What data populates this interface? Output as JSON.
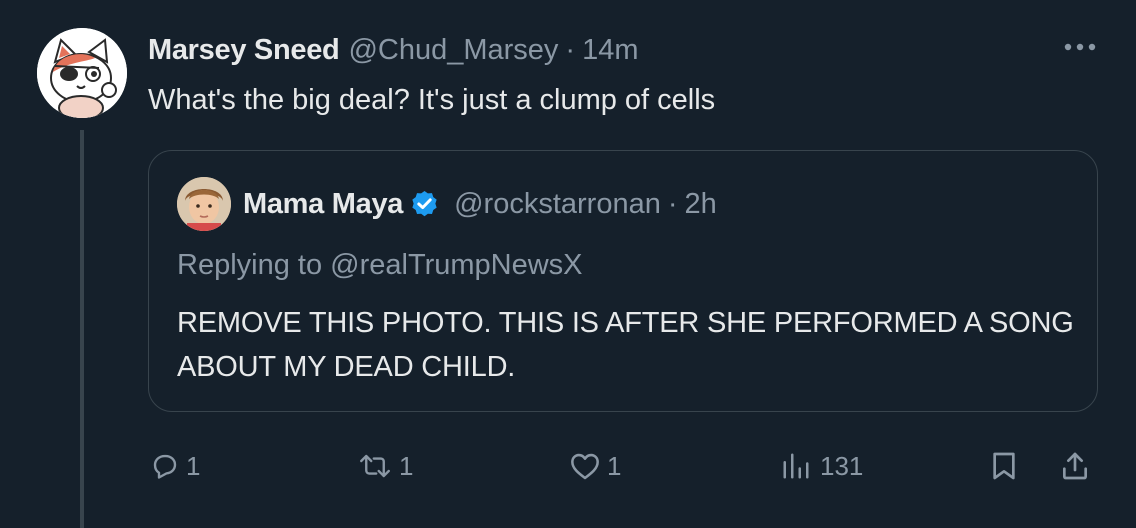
{
  "tweet": {
    "display_name": "Marsey Sneed",
    "handle": "@Chud_Marsey",
    "separator": "·",
    "time": "14m",
    "text": "What's the big deal? It's just a clump of cells"
  },
  "quote": {
    "display_name": "Mama Maya",
    "verified": true,
    "handle": "@rockstarronan",
    "separator": "·",
    "time": "2h",
    "replying_to": "Replying to @realTrumpNewsX",
    "text": "REMOVE THIS PHOTO. THIS IS AFTER SHE PERFORMED A SONG ABOUT MY DEAD CHILD."
  },
  "actions": {
    "replies": "1",
    "reposts": "1",
    "likes": "1",
    "views": "131"
  },
  "colors": {
    "background": "#15202b",
    "primary_text": "#e7e9ea",
    "secondary_text": "#8b98a5",
    "border": "#38444d",
    "verified_badge": "#1d9bf0"
  },
  "icons": {
    "more": "more-horizontal-icon",
    "verified": "verified-badge-icon",
    "reply": "reply-icon",
    "repost": "repost-icon",
    "like": "heart-icon",
    "views": "analytics-icon",
    "bookmark": "bookmark-icon",
    "share": "share-icon"
  }
}
